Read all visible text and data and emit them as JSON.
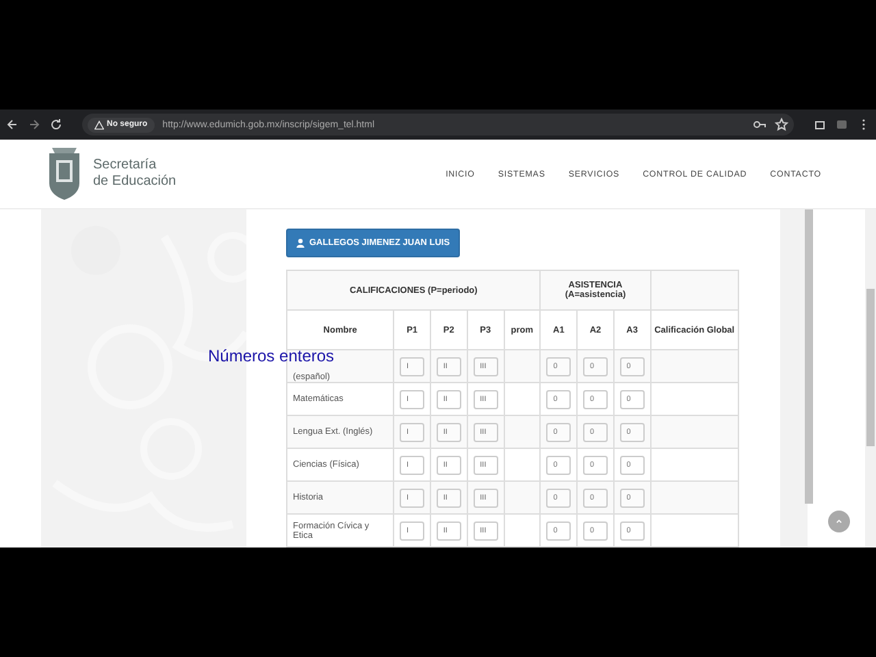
{
  "browser": {
    "security": "No seguro",
    "url": "http://www.edumich.gob.mx/inscrip/sigem_tel.html"
  },
  "site": {
    "name_line1": "Secretaría",
    "name_line2": "de Educación",
    "nav": [
      "INICIO",
      "SISTEMAS",
      "SERVICIOS",
      "CONTROL DE CALIDAD",
      "CONTACTO"
    ]
  },
  "student_button": "GALLEGOS JIMENEZ JUAN LUIS",
  "table": {
    "group_headers": [
      "CALIFICACIONES (P=periodo)",
      "ASISTENCIA (A=asistencia)"
    ],
    "columns": [
      "Nombre",
      "P1",
      "P2",
      "P3",
      "prom",
      "A1",
      "A2",
      "A3",
      "Calificación Global"
    ],
    "rows": [
      {
        "subject": "(español)",
        "placeholders": [
          "I",
          "II",
          "III"
        ],
        "attendance": [
          "0",
          "0",
          "0"
        ]
      },
      {
        "subject": "Matemáticas",
        "placeholders": [
          "I",
          "II",
          "III"
        ],
        "attendance": [
          "0",
          "0",
          "0"
        ]
      },
      {
        "subject": "Lengua Ext. (Inglés)",
        "placeholders": [
          "I",
          "II",
          "III"
        ],
        "attendance": [
          "0",
          "0",
          "0"
        ]
      },
      {
        "subject": "Ciencias (Física)",
        "placeholders": [
          "I",
          "II",
          "III"
        ],
        "attendance": [
          "0",
          "0",
          "0"
        ]
      },
      {
        "subject": "Historia",
        "placeholders": [
          "I",
          "II",
          "III"
        ],
        "attendance": [
          "0",
          "0",
          "0"
        ]
      },
      {
        "subject": "Formación Cívica y Etica",
        "placeholders": [
          "I",
          "II",
          "III"
        ],
        "attendance": [
          "0",
          "0",
          "0"
        ]
      }
    ]
  },
  "overlay_caption": "Números enteros"
}
